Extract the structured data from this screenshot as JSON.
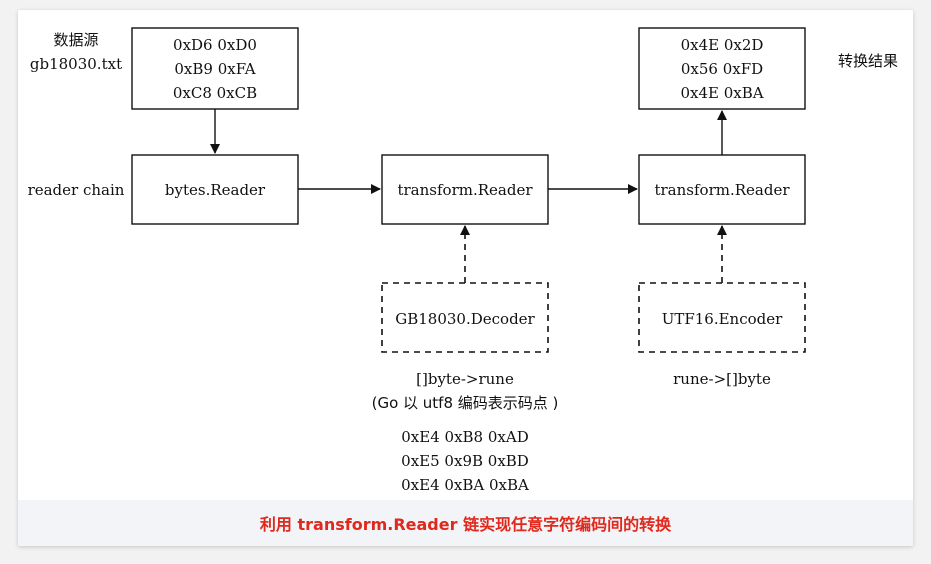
{
  "source": {
    "label_line1": "数据源",
    "label_line2": "gb18030.txt",
    "bytes": [
      "0xD6 0xD0",
      "0xB9 0xFA",
      "0xC8 0xCB"
    ]
  },
  "result": {
    "label": "转换结果",
    "bytes": [
      "0x4E 0x2D",
      "0x56 0xFD",
      "0x4E 0xBA"
    ]
  },
  "chain": {
    "label": "reader chain",
    "nodes": [
      "bytes.Reader",
      "transform.Reader",
      "transform.Reader"
    ]
  },
  "transformers": {
    "decoder": {
      "name": "GB18030.Decoder",
      "note_line1": "[]byte->rune",
      "note_line2": "(Go 以 utf8 编码表示码点 )",
      "bytes": [
        "0xE4 0xB8 0xAD",
        "0xE5 0x9B 0xBD",
        "0xE4 0xBA 0xBA"
      ]
    },
    "encoder": {
      "name": "UTF16.Encoder",
      "note": "rune->[]byte"
    }
  },
  "caption": "利用 transform.Reader 链实现任意字符编码间的转换"
}
